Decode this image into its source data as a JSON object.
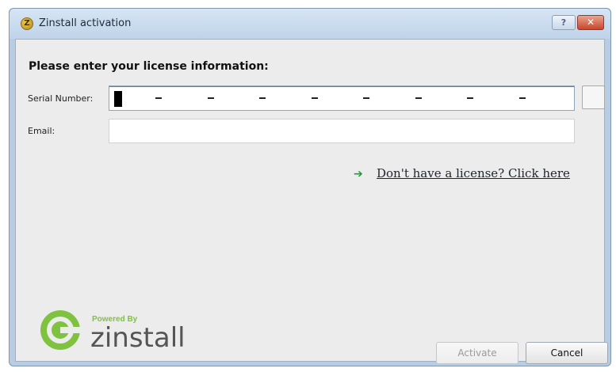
{
  "window": {
    "title": "Zinstall activation",
    "help_label": "?",
    "close_label": "✕"
  },
  "form": {
    "heading": "Please enter your license information:",
    "serial_label": "Serial Number:",
    "serial_value": "",
    "email_label": "Email:",
    "email_value": ""
  },
  "link": {
    "text": "Don't have a license? Click here",
    "icon": "green-arrow-right-icon"
  },
  "branding": {
    "powered_by": "Powered By",
    "brand": "zinstall"
  },
  "buttons": {
    "activate": "Activate",
    "cancel": "Cancel"
  },
  "colors": {
    "link_arrow": "#1e9c2f",
    "logo_green": "#7fc23f"
  }
}
